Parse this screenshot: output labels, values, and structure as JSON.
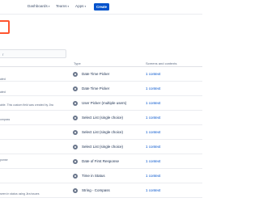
{
  "nav": {
    "dashboards": "Dashboards",
    "teams": "Teams",
    "apps": "Apps",
    "create": "Create"
  },
  "search": {
    "placeholder": "r"
  },
  "table": {
    "headers": {
      "type": "Type",
      "screens": "Screens and contexts"
    },
    "rows": [
      {
        "type": "Date Time Picker",
        "context": "1 context"
      },
      {
        "type": "Date Time Picker",
        "context": "1 context"
      },
      {
        "type": "User Picker (multiple users)",
        "context": "1 context"
      },
      {
        "type": "Select List (single choice)",
        "context": "1 context"
      },
      {
        "type": "Select List (single choice)",
        "context": "1 context"
      },
      {
        "type": "Select List (single choice)",
        "context": "1 context"
      },
      {
        "type": "Date of First Response",
        "context": "1 context"
      },
      {
        "type": "Time in Status",
        "context": "1 context"
      },
      {
        "type": "String - Compass",
        "context": "1 context"
      }
    ]
  },
  "left_column": {
    "text_1": "ated",
    "text_2": "ated",
    "text_3": "able. This custom field was created by Jira",
    "text_4": "ompass",
    "text_5": "ponse",
    "text_6": "seen in status using Jira issues"
  },
  "colors": {
    "brand": "#0052cc",
    "project_icon": "#ff5630",
    "link": "#0052cc"
  },
  "icons": {
    "type": "field-type-icon",
    "caret": "chevron-down-icon"
  }
}
